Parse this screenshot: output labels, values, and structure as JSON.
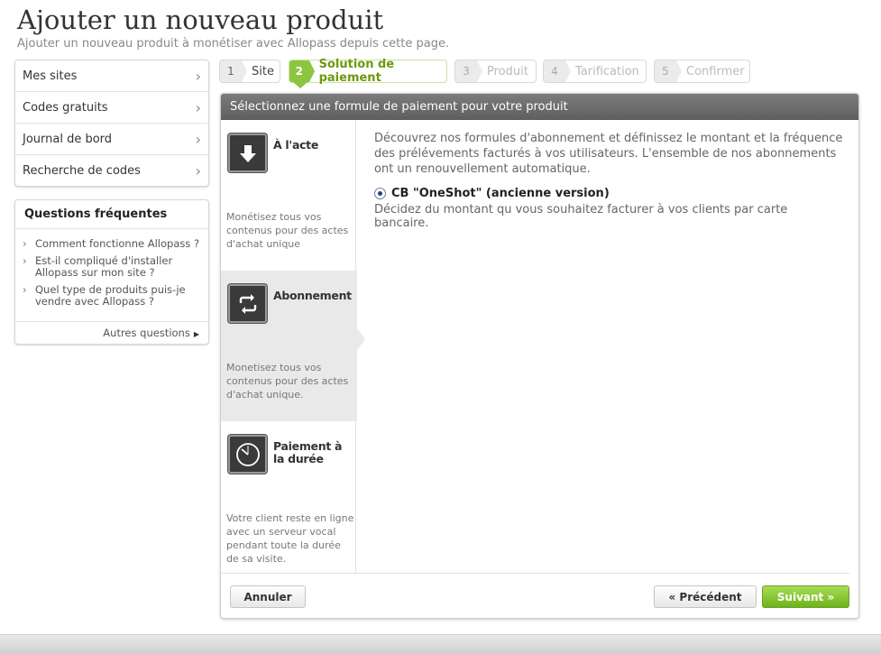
{
  "page": {
    "title": "Ajouter un nouveau produit",
    "subtitle": "Ajouter un nouveau produit à monétiser avec Allopass depuis cette page."
  },
  "sidebar": {
    "items": [
      {
        "label": "Mes sites"
      },
      {
        "label": "Codes gratuits"
      },
      {
        "label": "Journal de bord"
      },
      {
        "label": "Recherche de codes"
      }
    ]
  },
  "faq": {
    "title": "Questions fréquentes",
    "items": [
      {
        "label": "Comment fonctionne Allopass ?"
      },
      {
        "label": "Est-il compliqué d'installer Allopass sur mon site ?"
      },
      {
        "label": "Quel type de produits puis-je vendre avec Allopass ?"
      }
    ],
    "more_label": "Autres questions"
  },
  "steps": [
    {
      "num": "1",
      "label": "Site",
      "state": "done"
    },
    {
      "num": "2",
      "label": "Solution de paiement",
      "state": "active"
    },
    {
      "num": "3",
      "label": "Produit",
      "state": "pending"
    },
    {
      "num": "4",
      "label": "Tarification",
      "state": "pending"
    },
    {
      "num": "5",
      "label": "Confirmer",
      "state": "pending"
    }
  ],
  "panel": {
    "header": "Sélectionnez une formule de paiement pour votre produit",
    "methods": [
      {
        "title": "À l'acte",
        "desc": "Monétisez tous vos contenus pour des actes d'achat unique",
        "icon": "download-arrow-icon"
      },
      {
        "title": "Abonnement",
        "desc": "Monetisez tous vos contenus pour des actes d'achat unique.",
        "icon": "refresh-icon"
      },
      {
        "title": "Paiement à la durée",
        "desc": "Votre client reste en ligne avec un serveur vocal pendant toute la durée de sa visite.",
        "icon": "clock-icon"
      }
    ],
    "selected_method": "Abonnement",
    "intro": "Découvrez nos formules d'abonnement et définissez le montant et la fréquence des prélévements facturés à vos utilisateurs. L'ensemble de nos abonnements ont un renouvellement automatique.",
    "option_label": "CB \"OneShot\" (ancienne version)",
    "option_desc": "Décidez du montant qu vous souhaitez facturer à vos clients par carte bancaire."
  },
  "footer": {
    "cancel_label": "Annuler",
    "prev_label": "« Précédent",
    "next_label": "Suivant »"
  },
  "colors": {
    "accent_green": "#8cc63e",
    "header_gray": "#6e6e6e"
  }
}
